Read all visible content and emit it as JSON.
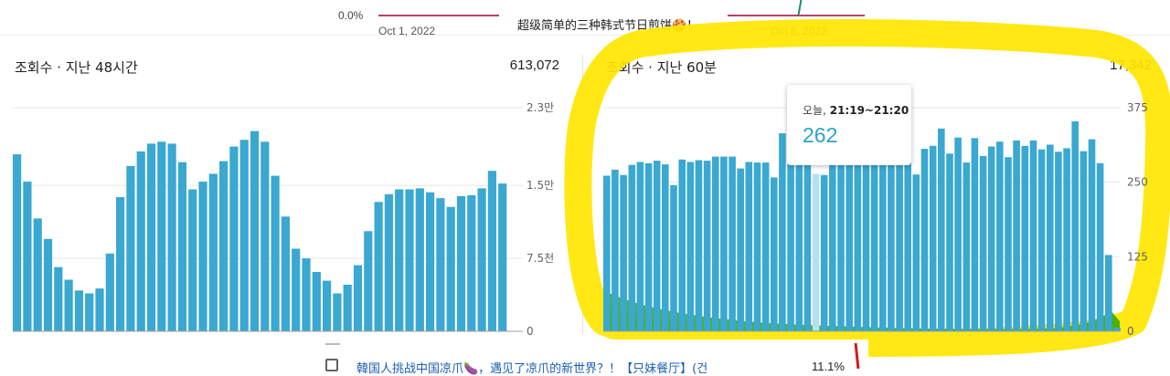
{
  "top": {
    "percent": "0.0%",
    "date1": "Oct 1, 2022",
    "video_title": "超级简单的三种韩式节日煎饼🍪！",
    "date2": "Oct 6, 2022"
  },
  "left_card": {
    "title": "조회수 · 지난 48시간",
    "total": "613,072"
  },
  "right_card": {
    "title": "조회수 · 지난 60분",
    "total": "17,342"
  },
  "tooltip": {
    "time_prefix": "오늘, ",
    "time_range": "21:19~21:20",
    "value": "262"
  },
  "bottom": {
    "video_link": "韓国人挑战中国凉爪🍆，遇见了凉爪的新世界？！【只妹餐厅】(건",
    "percent": "11.1%"
  },
  "colors": {
    "bar": "#3aa8d0",
    "bar_highlight": "#b8dff0",
    "grid": "#e6e6e6",
    "highlight_ring": "#ffe600",
    "realtime_area": "#2ea600"
  },
  "chart_data": [
    {
      "type": "bar",
      "title": "조회수 · 지난 48시간",
      "y_ticks": [
        {
          "label": "2.3만",
          "value": 23000
        },
        {
          "label": "1.5만",
          "value": 15000
        },
        {
          "label": "7.5천",
          "value": 7500
        },
        {
          "label": "0",
          "value": 0
        }
      ],
      "ylim": [
        0,
        23000
      ],
      "values": [
        18200,
        15400,
        11600,
        9500,
        6600,
        5300,
        4200,
        3900,
        4400,
        8000,
        13800,
        17000,
        18500,
        19300,
        19500,
        19300,
        17400,
        14600,
        15400,
        16200,
        17500,
        19000,
        19700,
        20600,
        19500,
        16000,
        11800,
        8500,
        7500,
        6100,
        5200,
        3900,
        4800,
        6800,
        10300,
        13300,
        14100,
        14600,
        14600,
        14700,
        14300,
        13700,
        12800,
        13900,
        14000,
        14700,
        16500,
        15200
      ],
      "grid": true
    },
    {
      "type": "bar",
      "title": "조회수 · 지난 60분",
      "y_ticks": [
        {
          "label": "375",
          "value": 375
        },
        {
          "label": "250",
          "value": 250
        },
        {
          "label": "125",
          "value": 125
        },
        {
          "label": "0",
          "value": 0
        }
      ],
      "ylim": [
        0,
        375
      ],
      "values": [
        261,
        271,
        262,
        279,
        284,
        282,
        286,
        280,
        245,
        288,
        284,
        287,
        286,
        293,
        293,
        293,
        273,
        284,
        283,
        283,
        258,
        332,
        323,
        294,
        314,
        264,
        262,
        283,
        285,
        295,
        298,
        283,
        311,
        321,
        300,
        301,
        305,
        263,
        306,
        311,
        340,
        298,
        325,
        283,
        324,
        294,
        310,
        318,
        292,
        320,
        311,
        320,
        305,
        313,
        301,
        307,
        352,
        302,
        322,
        282,
        128,
        6
      ],
      "highlight_index": 25,
      "grid": true
    }
  ]
}
